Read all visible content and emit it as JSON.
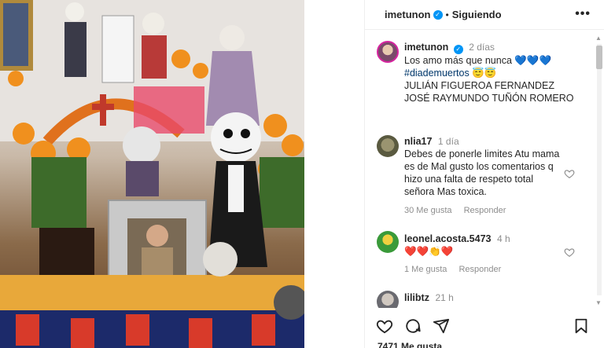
{
  "post": {
    "username": "imetunon",
    "follow_status": "Siguiendo",
    "caption": {
      "username": "imetunon",
      "time": "2 días",
      "line1": "Los amo más que nunca 💙💙💙",
      "hashtag": "#diademuertos",
      "hashtag_emojis": "😇😇",
      "line3": "JULIÁN FIGUEROA FERNANDEZ",
      "line4": "JOSÉ RAYMUNDO TUÑÓN ROMERO"
    },
    "comments": [
      {
        "username": "nlia17",
        "time": "1 día",
        "lines": [
          "Debes de ponerle limites Atu mama",
          "es de Mal gusto los comentarios q",
          "hizo una falta de respeto total",
          "señora Mas toxica."
        ],
        "likes": "30 Me gusta",
        "reply": "Responder"
      },
      {
        "username": "leonel.acosta.5473",
        "time": "4 h",
        "text": "❤️❤️👏❤️",
        "likes": "1 Me gusta",
        "reply": "Responder"
      },
      {
        "username": "lilibtz",
        "time": "21 h"
      }
    ],
    "likes_count": "7471 Me gusta"
  },
  "colors": {
    "accent": "#0095f6",
    "text": "#262626",
    "muted": "#8e8e8e"
  },
  "icons": [
    "heart-icon",
    "comment-icon",
    "share-icon",
    "bookmark-icon",
    "more-icon",
    "verified-icon"
  ]
}
